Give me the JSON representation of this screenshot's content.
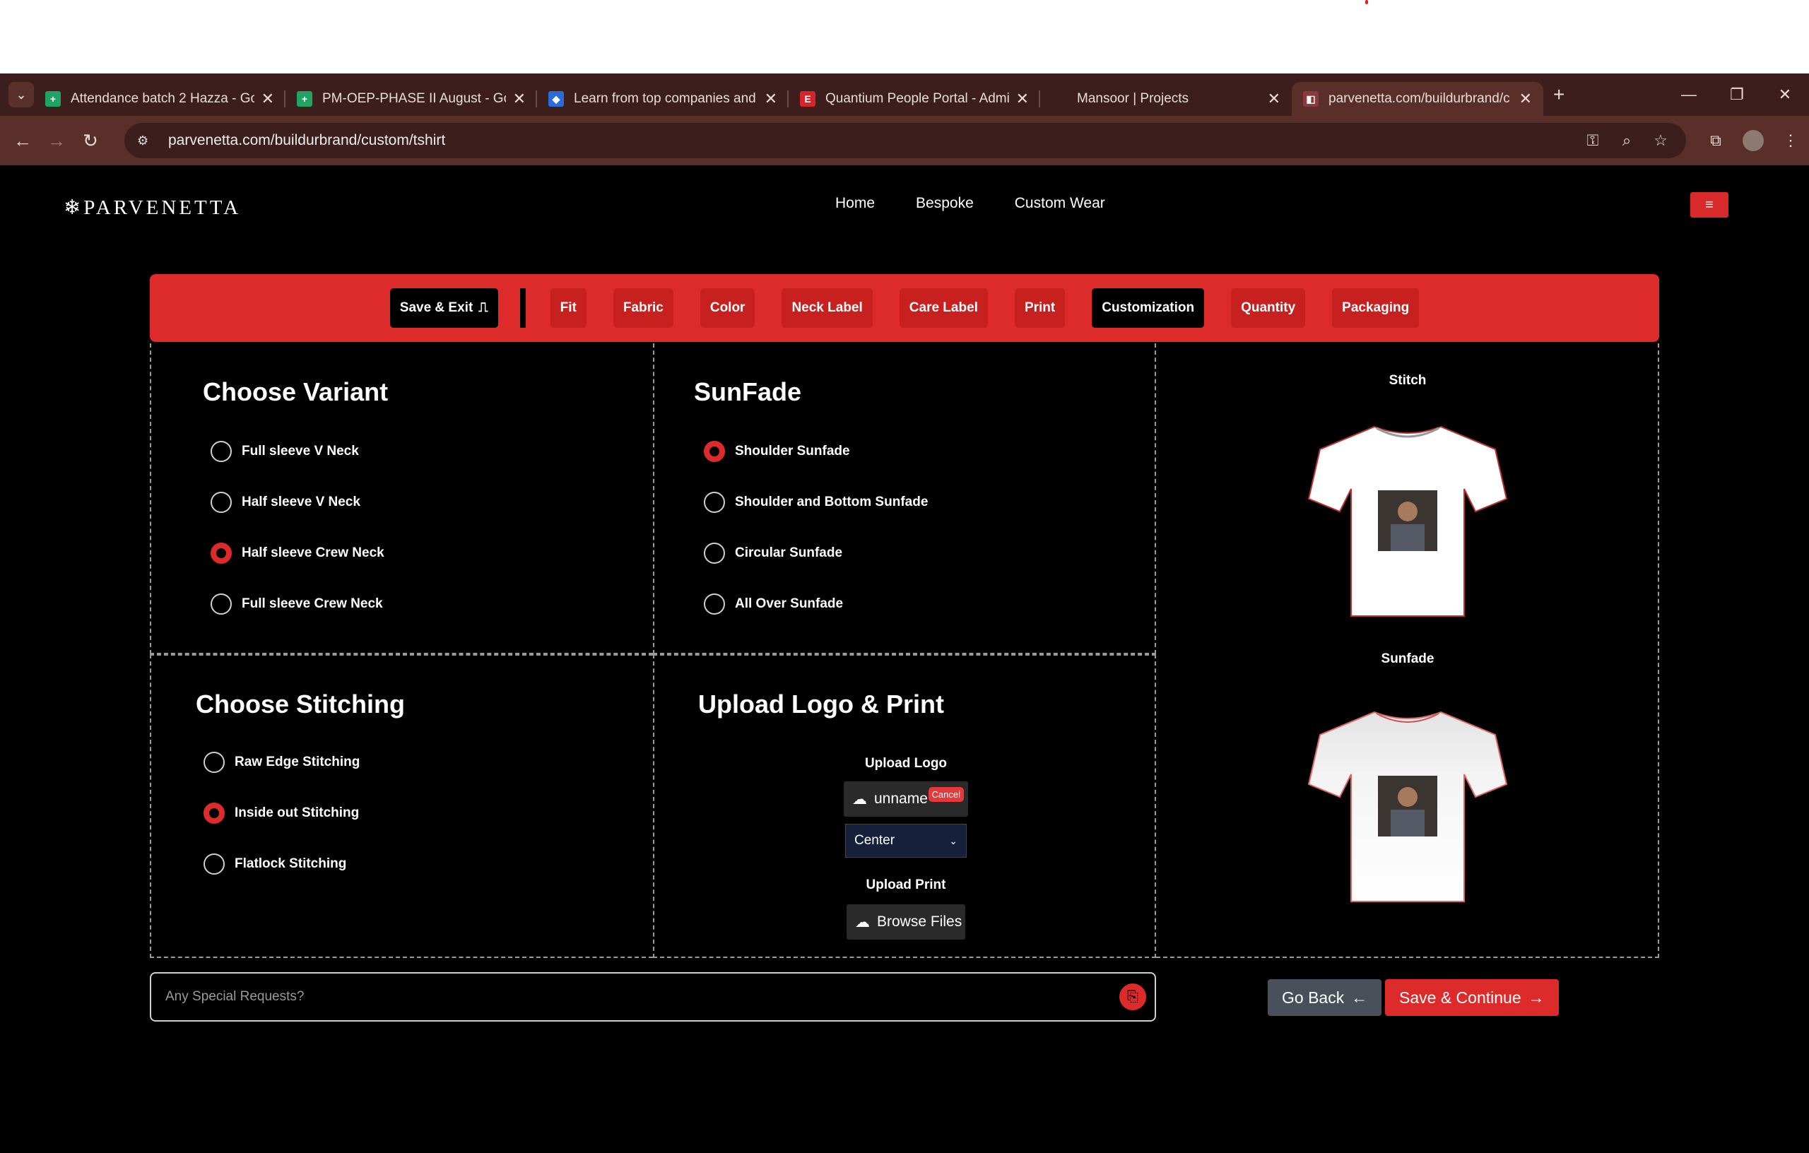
{
  "browser": {
    "tabs": [
      {
        "title": "Attendance batch 2 Hazza - Go",
        "fav": "+",
        "fav_color": "#1fa463"
      },
      {
        "title": "PM-OEP-PHASE II August - Goo",
        "fav": "+",
        "fav_color": "#1fa463"
      },
      {
        "title": "Learn from top companies and",
        "fav": "◆",
        "fav_color": "#2b6cd9"
      },
      {
        "title": "Quantium People Portal - Admi",
        "fav": "E",
        "fav_color": "#d9232b"
      },
      {
        "title": "Mansoor | Projects",
        "fav": "",
        "fav_color": "#3c1f1c"
      },
      {
        "title": "parvenetta.com/buildurbrand/c",
        "fav": "◧",
        "fav_color": "#8a3a3a"
      }
    ],
    "url": "parvenetta.com/buildurbrand/custom/tshirt"
  },
  "site": {
    "logo": "❄PARVENETTA",
    "nav": [
      "Home",
      "Bespoke",
      "Custom Wear"
    ]
  },
  "steps": {
    "save_exit": "Save & Exit",
    "items": [
      "Fit",
      "Fabric",
      "Color",
      "Neck Label",
      "Care Label",
      "Print",
      "Customization",
      "Quantity",
      "Packaging"
    ]
  },
  "variant": {
    "title": "Choose Variant",
    "options": [
      "Full sleeve V Neck",
      "Half sleeve V Neck",
      "Half sleeve Crew Neck",
      "Full sleeve Crew Neck"
    ],
    "selected": 2
  },
  "sunfade": {
    "title": "SunFade",
    "options": [
      "Shoulder Sunfade",
      "Shoulder and Bottom Sunfade",
      "Circular Sunfade",
      "All Over Sunfade"
    ],
    "selected": 0
  },
  "stitching": {
    "title": "Choose Stitching",
    "options": [
      "Raw Edge Stitching",
      "Inside out Stitching",
      "Flatlock Stitching"
    ],
    "selected": 1
  },
  "upload": {
    "title": "Upload Logo & Print",
    "logo_label": "Upload Logo",
    "logo_file": "unname",
    "cancel": "Cancel",
    "position": "Center",
    "print_label": "Upload Print",
    "browse": "Browse Files"
  },
  "preview": {
    "stitch_label": "Stitch",
    "sunfade_label": "Sunfade"
  },
  "footer": {
    "special_placeholder": "Any Special Requests?",
    "go_back": "Go Back",
    "save_continue": "Save & Continue"
  },
  "colors": {
    "accent": "#dd2a2a",
    "tabbar": "#3c1f1c"
  }
}
